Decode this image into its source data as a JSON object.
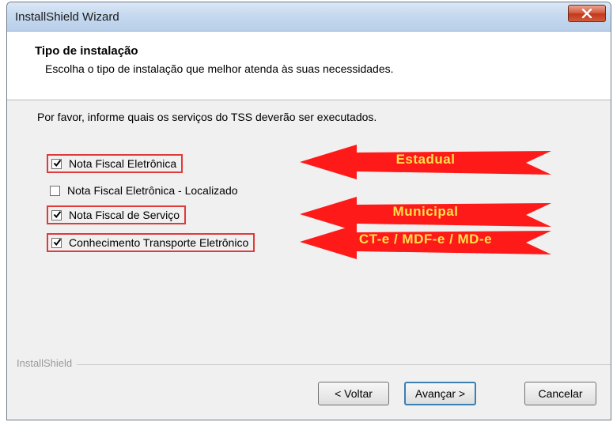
{
  "window": {
    "title": "InstallShield Wizard"
  },
  "header": {
    "title": "Tipo de instalação",
    "description": "Escolha o tipo de instalação que melhor atenda às suas necessidades."
  },
  "body": {
    "instruction": "Por favor, informe quais os serviços do TSS deverão ser executados.",
    "options": [
      {
        "label": "Nota Fiscal Eletrônica",
        "checked": true
      },
      {
        "label": "Nota Fiscal Eletrônica - Localizado",
        "checked": false
      },
      {
        "label": "Nota Fiscal de Serviço",
        "checked": true
      },
      {
        "label": "Conhecimento Transporte Eletrônico",
        "checked": true
      }
    ],
    "annotations": [
      {
        "label": "Estadual"
      },
      {
        "label": "Municipal"
      },
      {
        "label": "CT-e / MDF-e / MD-e"
      }
    ],
    "annotation_colors": {
      "arrow": "#ff1a1a",
      "text": "#ffe04a",
      "highlight_box": "#e03a3a"
    }
  },
  "footer": {
    "brand": "InstallShield",
    "buttons": {
      "back": "< Voltar",
      "next": "Avançar >",
      "cancel": "Cancelar"
    }
  },
  "icons": {
    "close": "close-icon",
    "checkmark": "checkmark-icon"
  }
}
